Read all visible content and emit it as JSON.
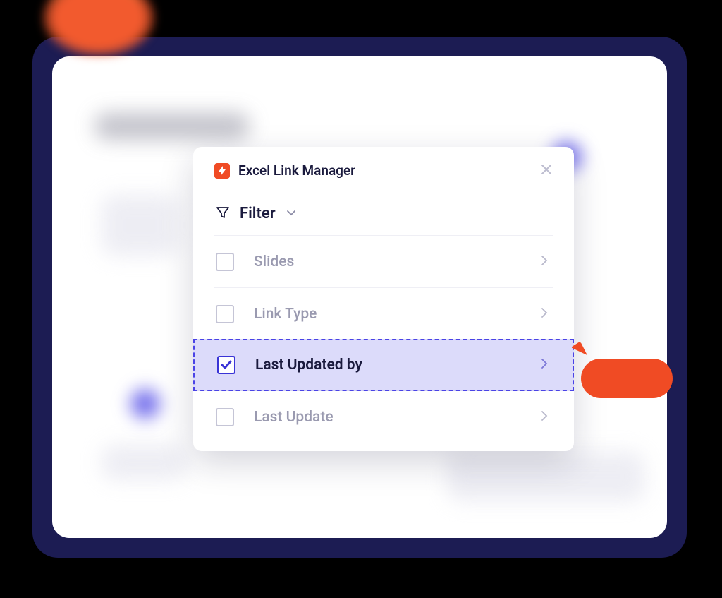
{
  "panel": {
    "title": "Excel Link Manager",
    "filter_label": "Filter",
    "options": [
      {
        "label": "Slides",
        "checked": false
      },
      {
        "label": "Link Type",
        "checked": false
      },
      {
        "label": "Last Updated by",
        "checked": true
      },
      {
        "label": "Last Update",
        "checked": false
      }
    ]
  },
  "colors": {
    "accent_orange": "#f04b24",
    "accent_blue": "#4a43e6",
    "text_dark": "#1a1a3d"
  }
}
